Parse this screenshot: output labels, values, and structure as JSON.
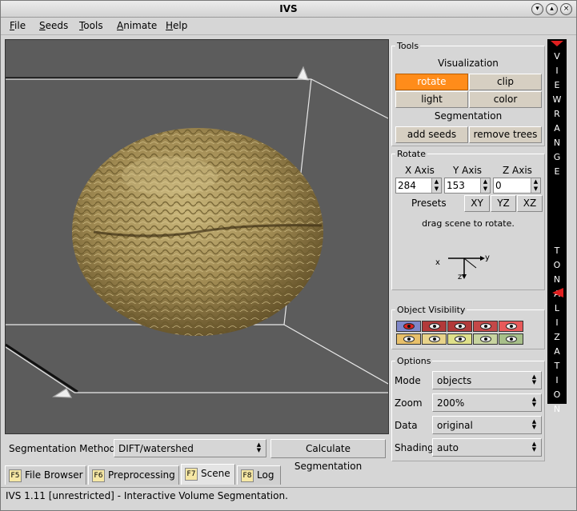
{
  "window": {
    "title": "IVS"
  },
  "menu": [
    {
      "accel": "F",
      "rest": "ile"
    },
    {
      "accel": "S",
      "rest": "eeds"
    },
    {
      "accel": "T",
      "rest": "ools"
    },
    {
      "accel": "A",
      "rest": "nimate"
    },
    {
      "accel": "H",
      "rest": "elp"
    }
  ],
  "tools": {
    "title": "Tools",
    "visualization_title": "Visualization",
    "rotate": "rotate",
    "clip": "clip",
    "light": "light",
    "color": "color",
    "segmentation_title": "Segmentation",
    "add_seeds": "add seeds",
    "remove_trees": "remove trees",
    "active_tool": "rotate"
  },
  "rotate": {
    "title": "Rotate",
    "x_label": "X Axis",
    "y_label": "Y Axis",
    "z_label": "Z Axis",
    "x_value": "284",
    "y_value": "153",
    "z_value": "0",
    "presets_label": "Presets",
    "xy": "XY",
    "yz": "YZ",
    "xz": "XZ",
    "hint": "drag scene to rotate.",
    "axis_x": "x",
    "axis_y": "y",
    "axis_z": "z"
  },
  "side": {
    "view_range": [
      "V",
      "I",
      "E",
      "W",
      "R",
      "A",
      "N",
      "G",
      "E"
    ],
    "tonalization": [
      "T",
      "O",
      "N",
      "A",
      "L",
      "I",
      "Z",
      "A",
      "T",
      "I",
      "O",
      "N"
    ]
  },
  "visibility": {
    "title": "Object Visibility",
    "colors_row1": [
      "#7f87c9",
      "#b23a3a",
      "#b23a3a",
      "#c44848",
      "#e85a5a"
    ],
    "colors_row2": [
      "#e8c06a",
      "#e8d38a",
      "#dfe08a",
      "#c8d4a0",
      "#a8c08a"
    ]
  },
  "options": {
    "title": "Options",
    "mode_label": "Mode",
    "mode_value": "objects",
    "zoom_label": "Zoom",
    "zoom_value": "200%",
    "data_label": "Data",
    "data_value": "original",
    "shading_label": "Shading",
    "shading_value": "auto"
  },
  "segmentation": {
    "label": "Segmentation Method:",
    "value": "DIFT/watershed",
    "calculate": "Calculate Segmentation"
  },
  "tabs": [
    {
      "key": "F5",
      "label": "File Browser"
    },
    {
      "key": "F6",
      "label": "Preprocessing"
    },
    {
      "key": "F7",
      "label": "Scene"
    },
    {
      "key": "F8",
      "label": "Log"
    }
  ],
  "active_tab": "Scene",
  "status": "IVS 1.11 [unrestricted] - Interactive Volume Segmentation.",
  "colors": {
    "accent": "#ff8c1a",
    "viewport_bg": "#5c5c5c",
    "brain": "#a08a52"
  }
}
